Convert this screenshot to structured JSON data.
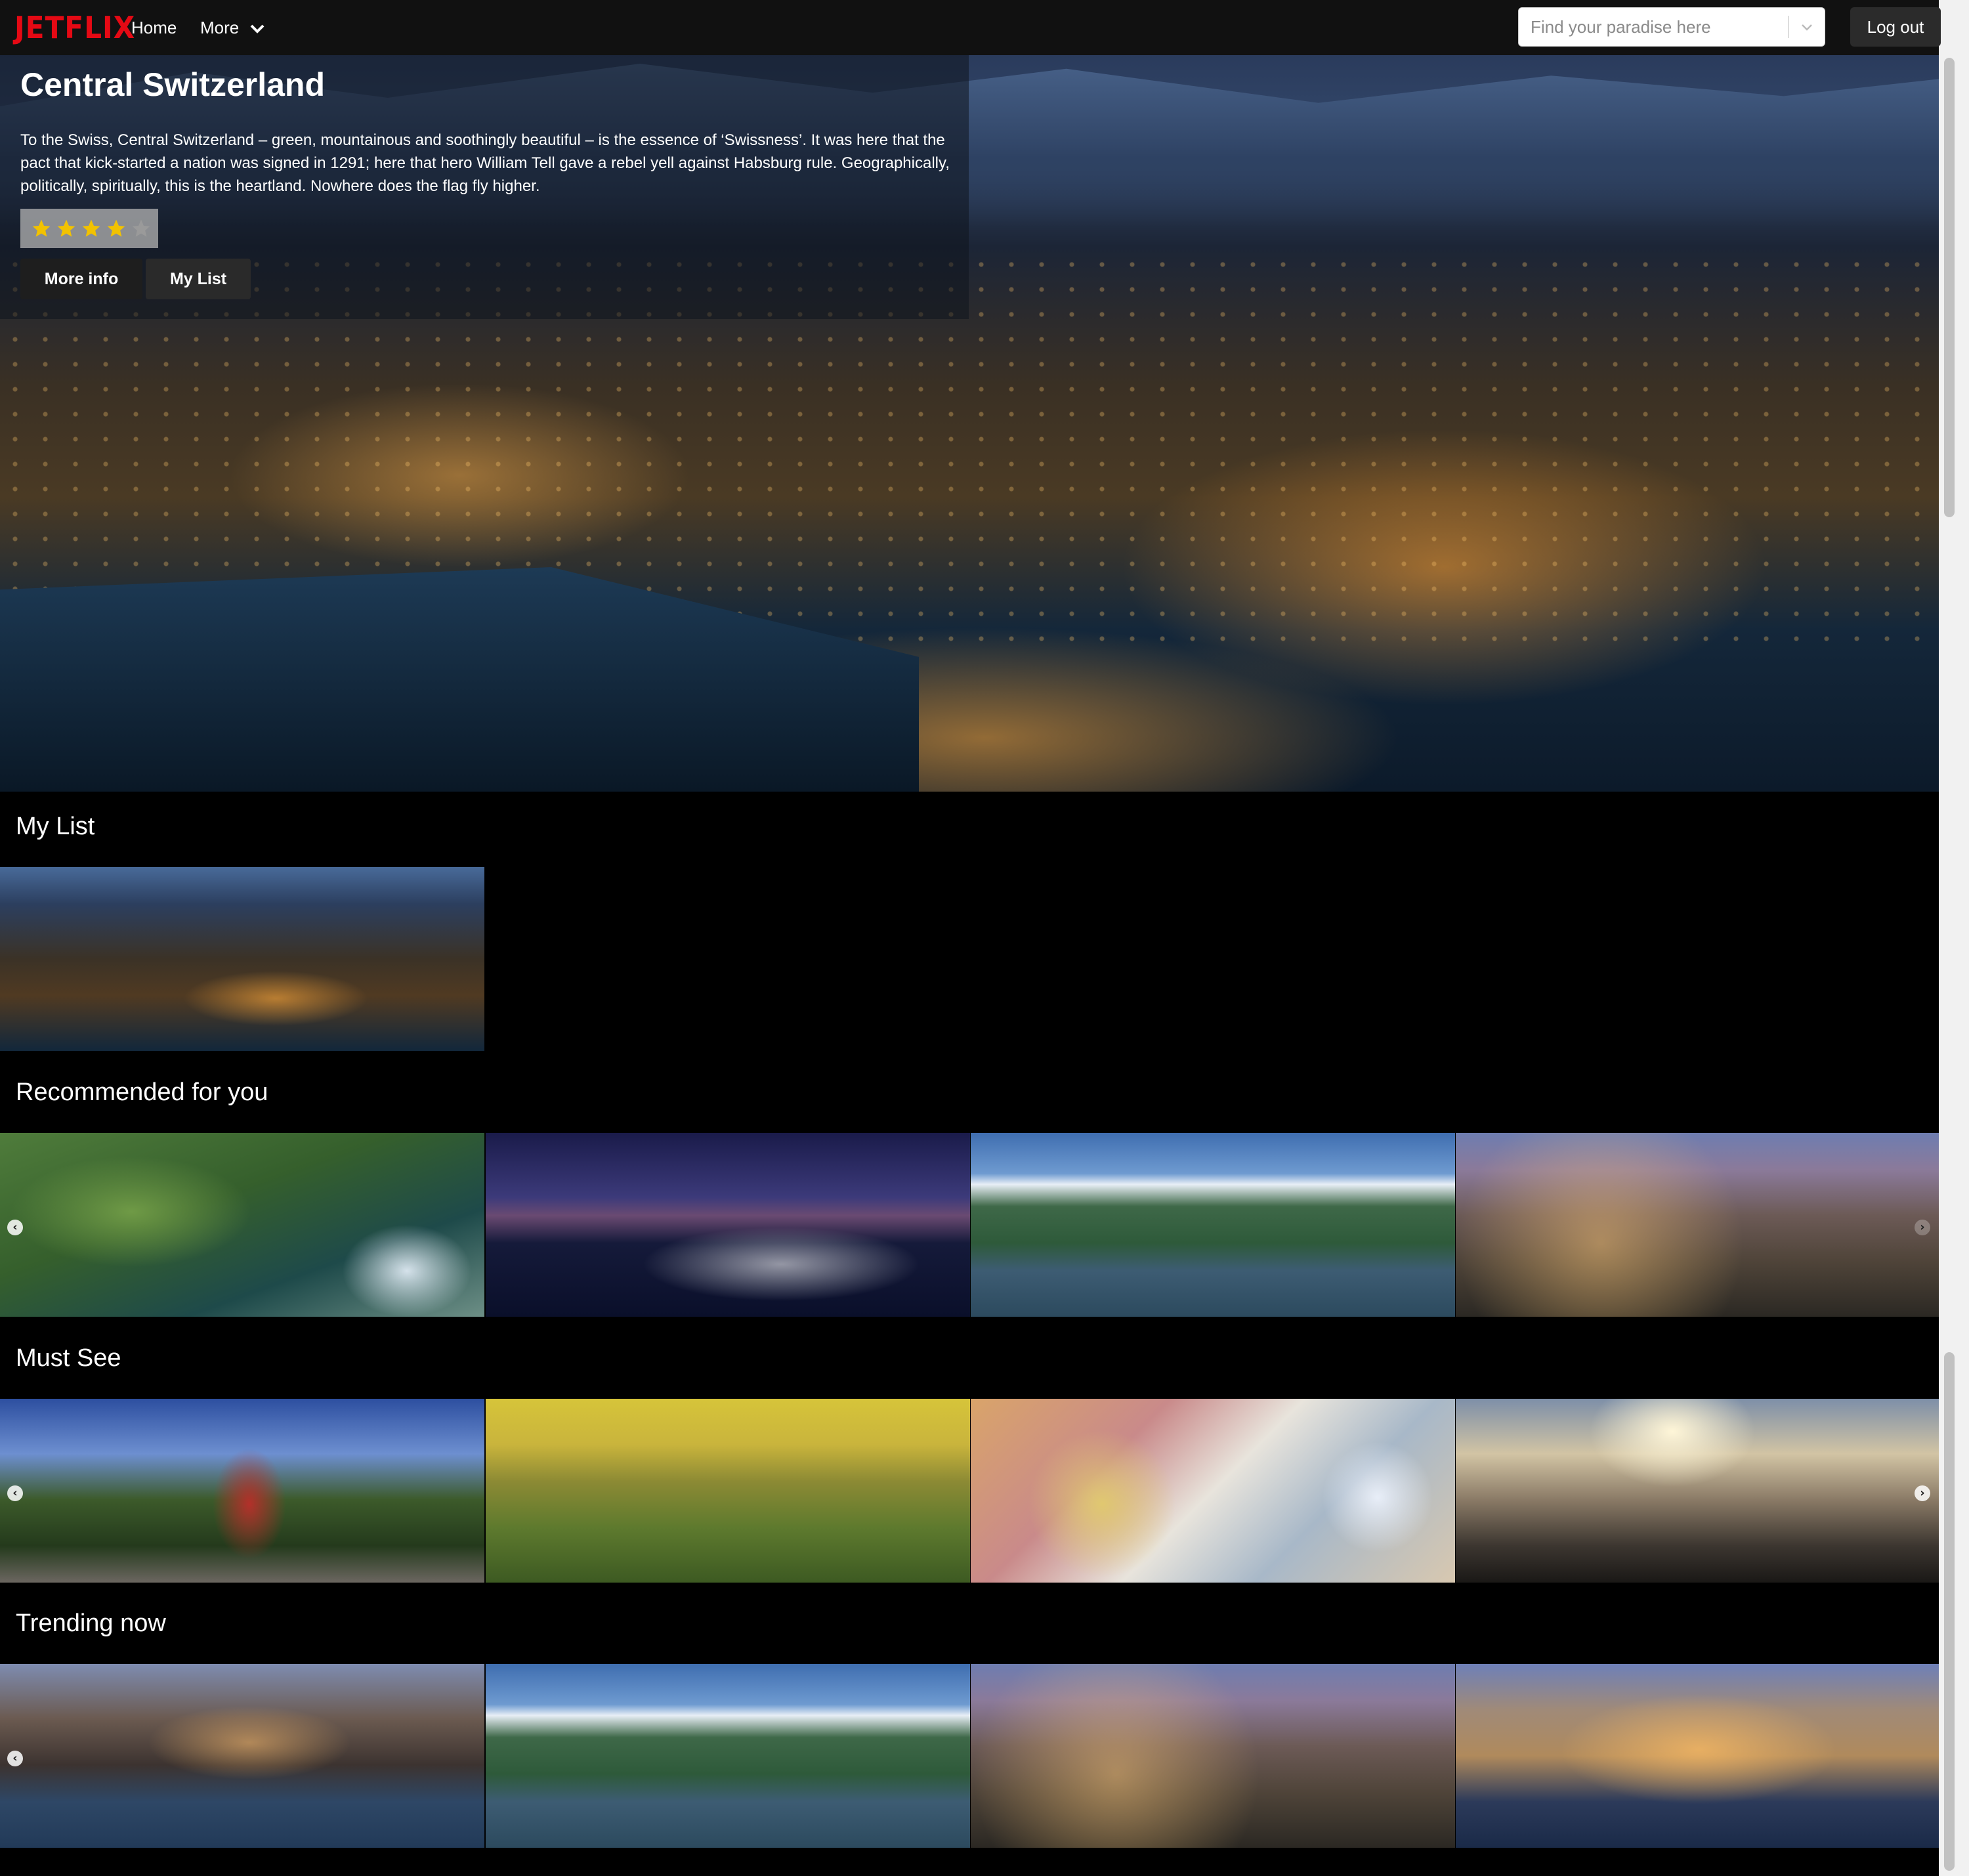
{
  "brand": {
    "logo_text": "JETFLIX",
    "logo_color": "#e50914"
  },
  "nav": {
    "home_label": "Home",
    "more_label": "More",
    "search_placeholder": "Find your paradise here",
    "logout_label": "Log out"
  },
  "hero": {
    "title": "Central Switzerland",
    "description": "To the Swiss, Central Switzerland – green, mountainous and soothingly beautiful – is the essence of ‘Swissness’. It was here that the pact that kick-started a nation was signed in 1291; here that hero William Tell gave a rebel yell against Habsburg rule. Geographically, politically, spiritually, this is the heartland. Nowhere does the flag fly higher.",
    "rating": 4,
    "rating_max": 5,
    "more_info_label": "More info",
    "my_list_label": "My List"
  },
  "rows": [
    {
      "title": "My List",
      "tiles": [
        "luzern-night"
      ]
    },
    {
      "title": "Recommended for you",
      "tiles": [
        "guatape-lake",
        "lit-bridge",
        "pokhara-lake",
        "city-dusk"
      ]
    },
    {
      "title": "Must See",
      "tiles": [
        "red-windmill",
        "golden-vineyard",
        "gaudi-mosaic",
        "seaside-promenade"
      ]
    },
    {
      "title": "Trending now",
      "tiles": [
        "harbor-town",
        "pokhara-lake",
        "city-dusk",
        "marseille-port"
      ]
    }
  ],
  "icons": {
    "nav_more": "chevron-down-icon",
    "search_toggle": "chevron-down-icon",
    "rating": "star-icon",
    "row_prev": "chevron-left-icon",
    "row_next": "chevron-right-icon"
  }
}
